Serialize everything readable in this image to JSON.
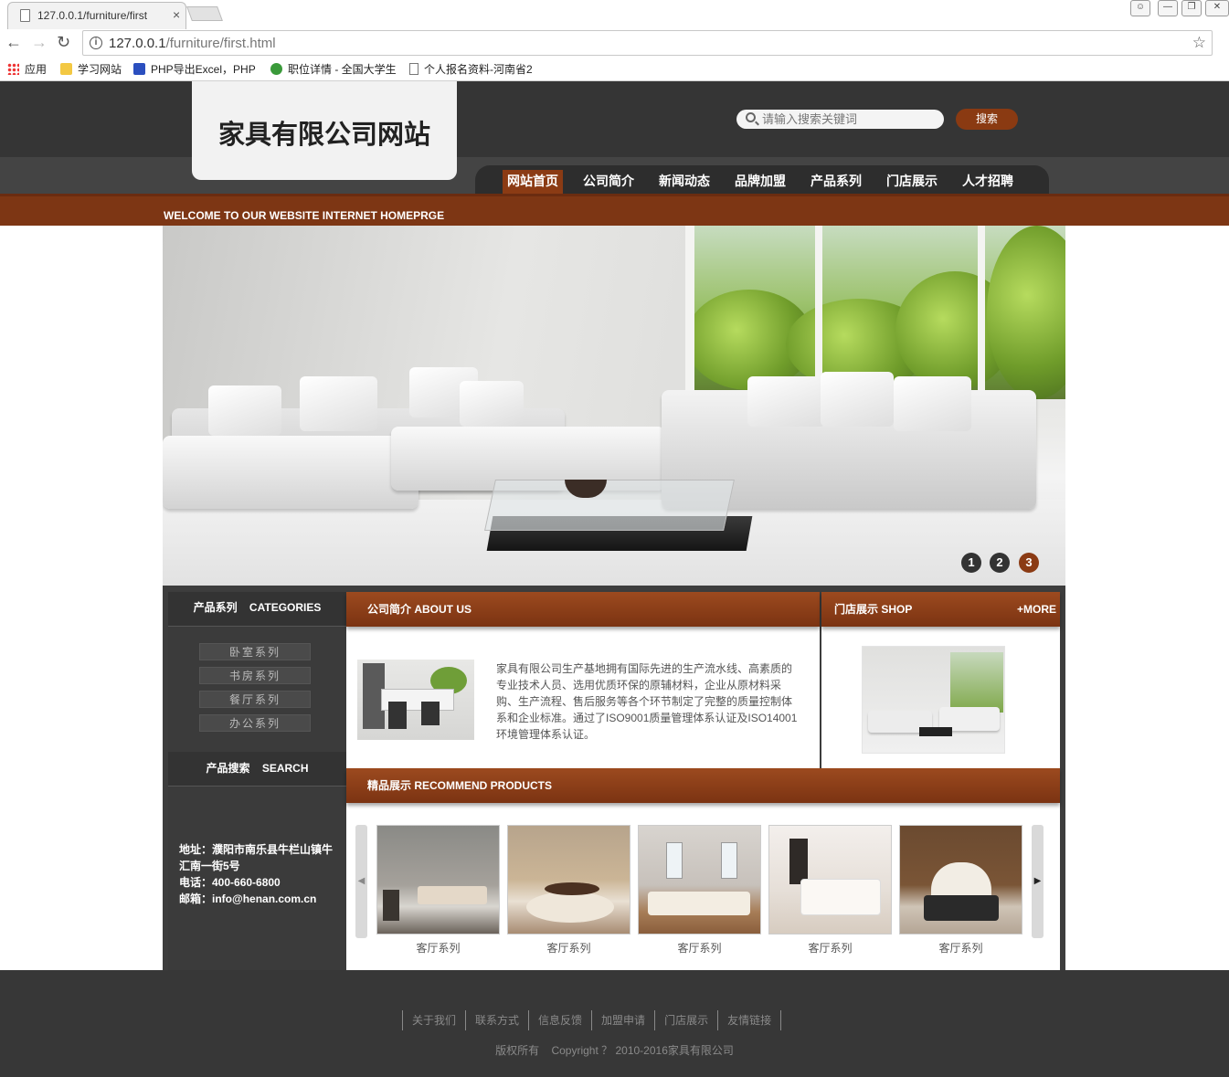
{
  "browser": {
    "tab_title": "127.0.0.1/furniture/first",
    "url_host": "127.0.0.1",
    "url_path": "/furniture/first.html",
    "bookmarks": [
      "应用",
      "学习网站",
      "PHP导出Excel，PHP",
      "职位详情 - 全国大学生",
      "个人报名资料-河南省2"
    ]
  },
  "header": {
    "logo": "家具有限公司网站",
    "search_placeholder": "请输入搜索关键词",
    "search_button": "搜索",
    "nav": [
      "网站首页",
      "公司简介",
      "新闻动态",
      "品牌加盟",
      "产品系列",
      "门店展示",
      "人才招聘"
    ],
    "active_nav": 0,
    "welcome": "WELCOME TO OUR WEBSITE INTERNET HOMEPRGE"
  },
  "banner": {
    "slides": [
      "1",
      "2",
      "3"
    ],
    "active_slide": 2
  },
  "sidebar": {
    "categories_title": "产品系列    CATEGORIES",
    "categories": [
      "卧室系列",
      "书房系列",
      "餐厅系列",
      "办公系列"
    ],
    "search_title": "产品搜索    SEARCH",
    "address": "地址：濮阳市南乐县牛栏山镇牛汇南一街5号",
    "phone": "电话：400-660-6800",
    "email": "邮箱：info@henan.com.cn"
  },
  "about": {
    "title": "公司简介 ABOUT US",
    "text": "家具有限公司生产基地拥有国际先进的生产流水线、高素质的专业技术人员、选用优质环保的原辅材料，企业从原材料采购、生产流程、售后服务等各个环节制定了完整的质量控制体系和企业标准。通过了ISO9001质量管理体系认证及ISO14001环境管理体系认证。"
  },
  "shop": {
    "title": "门店展示 SHOP",
    "more": "+MORE"
  },
  "recommend": {
    "title": "精品展示 RECOMMEND PRODUCTS",
    "products": [
      {
        "caption": "客厅系列"
      },
      {
        "caption": "客厅系列"
      },
      {
        "caption": "客厅系列"
      },
      {
        "caption": "客厅系列"
      },
      {
        "caption": "客厅系列"
      }
    ]
  },
  "footer": {
    "links": [
      "关于我们",
      "联系方式",
      "信息反馈",
      "加盟申请",
      "门店展示",
      "友情链接"
    ],
    "copyright": "版权所有    Copyright ？ 2010-2016家具有限公司"
  },
  "colors": {
    "accent": "#8b3b14",
    "header_bg": "#353535",
    "footer_bg": "#373737"
  }
}
